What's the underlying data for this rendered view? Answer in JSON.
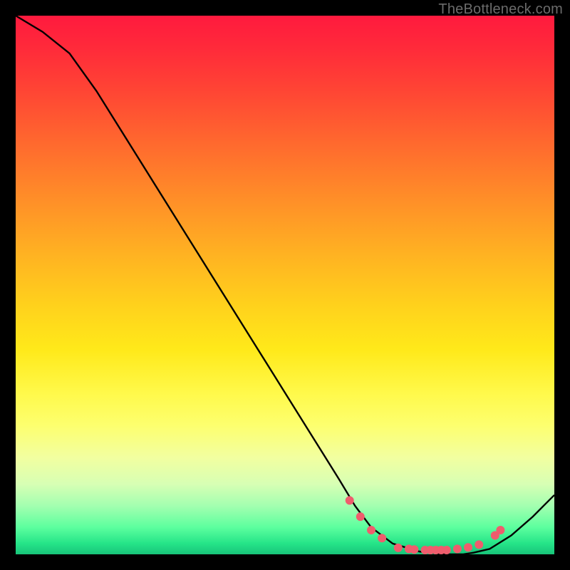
{
  "watermark": "TheBottleneck.com",
  "chart_data": {
    "type": "line",
    "title": "",
    "xlabel": "",
    "ylabel": "",
    "xlim": [
      0,
      100
    ],
    "ylim": [
      0,
      100
    ],
    "series": [
      {
        "name": "curve",
        "x": [
          0,
          5,
          10,
          15,
          20,
          25,
          30,
          35,
          40,
          45,
          50,
          55,
          60,
          63,
          66,
          70,
          75,
          80,
          83,
          85,
          88,
          92,
          96,
          100
        ],
        "y": [
          100,
          97,
          93,
          86,
          78,
          70,
          62,
          54,
          46,
          38,
          30,
          22,
          14,
          9,
          5,
          2,
          0.5,
          0,
          0,
          0.3,
          1,
          3.5,
          7,
          11
        ]
      }
    ],
    "markers": [
      {
        "x": 62,
        "y": 10
      },
      {
        "x": 64,
        "y": 7
      },
      {
        "x": 66,
        "y": 4.5
      },
      {
        "x": 68,
        "y": 3
      },
      {
        "x": 71,
        "y": 1.2
      },
      {
        "x": 73,
        "y": 1.0
      },
      {
        "x": 74,
        "y": 0.9
      },
      {
        "x": 76,
        "y": 0.8
      },
      {
        "x": 77,
        "y": 0.8
      },
      {
        "x": 78,
        "y": 0.8
      },
      {
        "x": 79,
        "y": 0.8
      },
      {
        "x": 80,
        "y": 0.8
      },
      {
        "x": 82,
        "y": 1.0
      },
      {
        "x": 84,
        "y": 1.3
      },
      {
        "x": 86,
        "y": 1.8
      },
      {
        "x": 89,
        "y": 3.5
      },
      {
        "x": 90,
        "y": 4.5
      }
    ],
    "marker_color": "#ef5d6d",
    "curve_color": "#000000"
  }
}
